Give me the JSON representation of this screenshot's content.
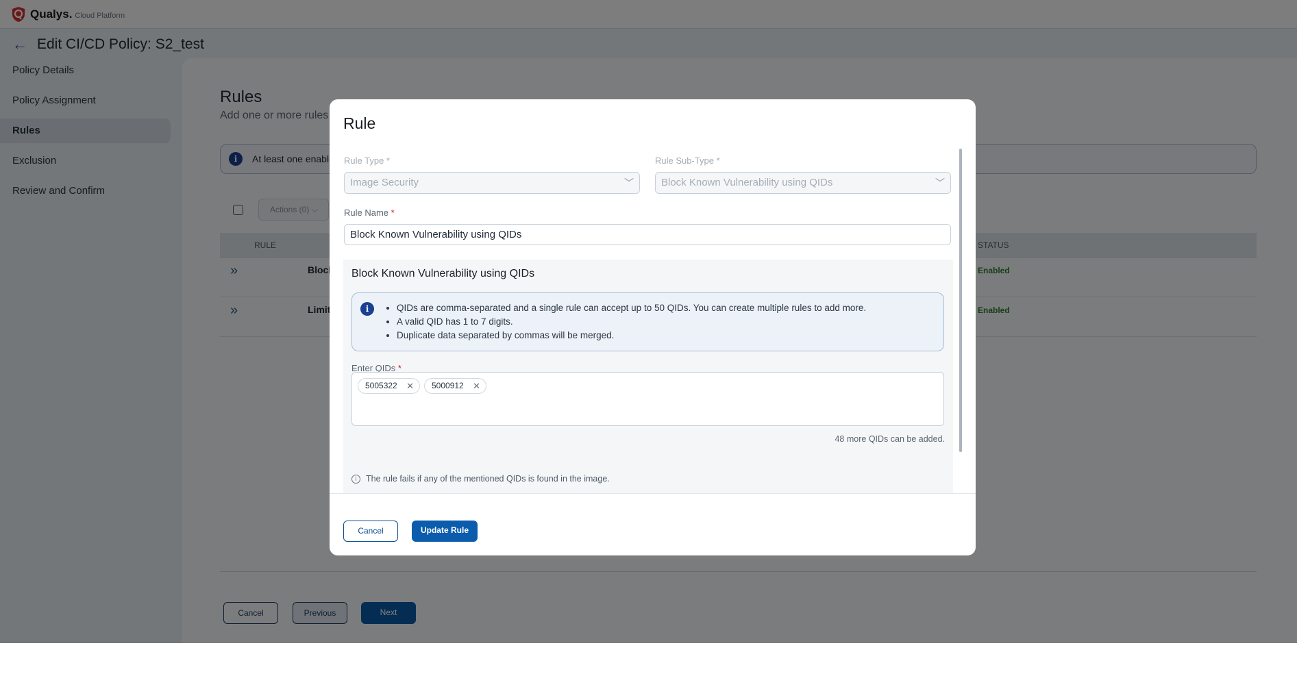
{
  "header": {
    "brand": "Qualys.",
    "brand_sub": "Cloud Platform"
  },
  "page": {
    "title": "Edit CI/CD Policy: S2_test"
  },
  "sidebar": {
    "items": [
      {
        "label": "Policy Details"
      },
      {
        "label": "Policy Assignment"
      },
      {
        "label": "Rules",
        "active": true
      },
      {
        "label": "Exclusion"
      },
      {
        "label": "Review and Confirm"
      }
    ]
  },
  "main": {
    "heading": "Rules",
    "subtitle": "Add one or more rules",
    "banner": "At least one enable",
    "actions_label": "Actions (0)",
    "columns": {
      "rule": "RULE",
      "status": "STATUS"
    },
    "rows": [
      {
        "name": "Block",
        "status": "Enabled"
      },
      {
        "name": "Limit",
        "status": "Enabled"
      }
    ],
    "buttons": {
      "cancel": "Cancel",
      "previous": "Previous",
      "next": "Next"
    }
  },
  "modal": {
    "title": "Rule",
    "rule_type_label": "Rule Type",
    "rule_type_value": "Image Security",
    "sub_type_label": "Rule Sub-Type",
    "sub_type_value": "Block Known Vulnerability using QIDs",
    "rule_name_label": "Rule Name",
    "rule_name_value": "Block Known Vulnerability using QIDs",
    "required_mark": "*",
    "section_title": "Block Known Vulnerability using QIDs",
    "info": [
      "QIDs are comma-separated and a single rule can accept up to 50 QIDs. You can create multiple rules to add more.",
      "A valid QID has 1 to 7 digits.",
      "Duplicate data separated by commas will be merged."
    ],
    "qids_label": "Enter QIDs",
    "qids": [
      "5005322",
      "5000912"
    ],
    "remaining": "48 more QIDs can be added.",
    "footnote": "The rule fails if any of the mentioned QIDs is found in the image.",
    "cancel": "Cancel",
    "update": "Update Rule"
  },
  "colors": {
    "primary": "#0b5cad",
    "enabled": "#2f7d32",
    "info_icon": "#1b3f91"
  }
}
